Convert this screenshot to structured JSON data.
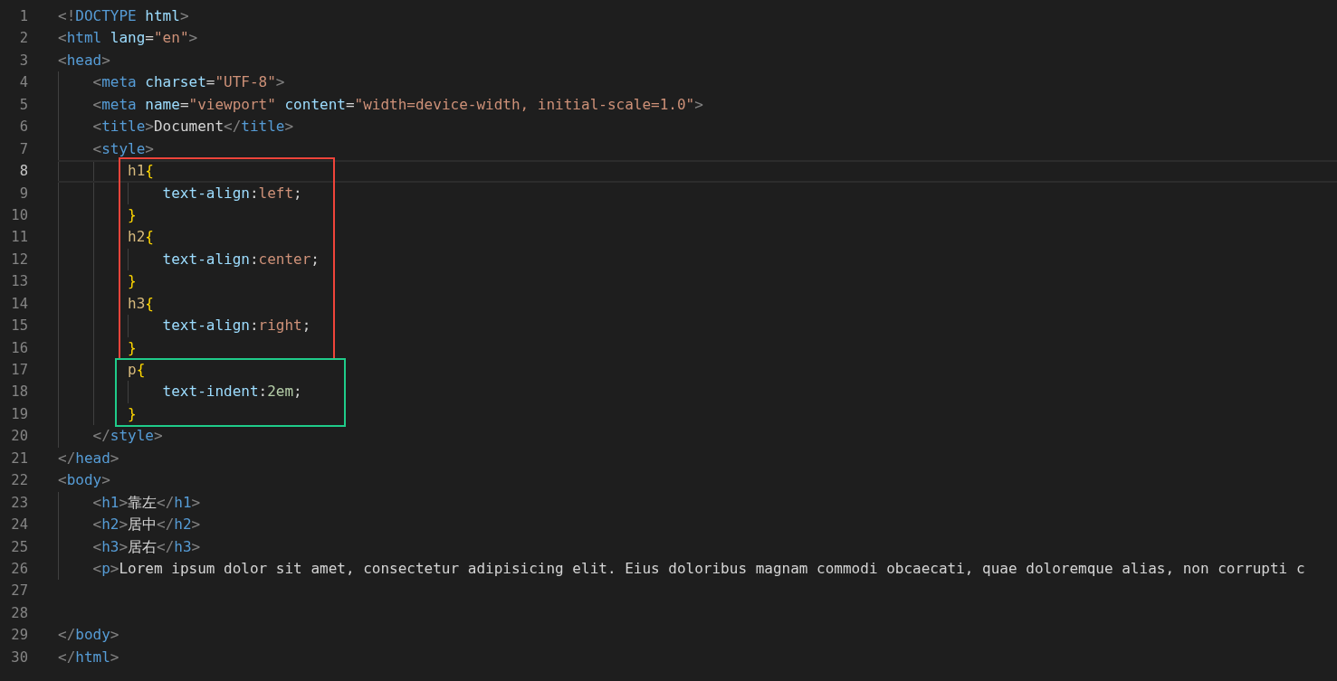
{
  "editor": {
    "sections": [
      {
        "lines": [
          {
            "number": "1",
            "current": false,
            "tokens": [
              {
                "kind": "punct",
                "text": "<!"
              },
              {
                "kind": "tag",
                "text": "DOCTYPE"
              },
              {
                "kind": "attr",
                "text": " html"
              },
              {
                "kind": "punct",
                "text": ">"
              }
            ]
          },
          {
            "number": "2",
            "current": false,
            "tokens": [
              {
                "kind": "punct",
                "text": "<"
              },
              {
                "kind": "tag",
                "text": "html"
              },
              {
                "kind": "attr",
                "text": " lang"
              },
              {
                "kind": "plain",
                "text": "="
              },
              {
                "kind": "string",
                "text": "\"en\""
              },
              {
                "kind": "punct",
                "text": ">"
              }
            ]
          },
          {
            "number": "3",
            "current": false,
            "tokens": [
              {
                "kind": "punct",
                "text": "<"
              },
              {
                "kind": "tag",
                "text": "head"
              },
              {
                "kind": "punct",
                "text": ">"
              }
            ]
          },
          {
            "number": "4",
            "current": false,
            "tokens": [
              {
                "kind": "punct",
                "text": "    <"
              },
              {
                "kind": "tag",
                "text": "meta"
              },
              {
                "kind": "attr",
                "text": " charset"
              },
              {
                "kind": "plain",
                "text": "="
              },
              {
                "kind": "string",
                "text": "\"UTF-8\""
              },
              {
                "kind": "punct",
                "text": ">"
              }
            ]
          },
          {
            "number": "5",
            "current": false,
            "tokens": [
              {
                "kind": "punct",
                "text": "    <"
              },
              {
                "kind": "tag",
                "text": "meta"
              },
              {
                "kind": "attr",
                "text": " name"
              },
              {
                "kind": "plain",
                "text": "="
              },
              {
                "kind": "string",
                "text": "\"viewport\""
              },
              {
                "kind": "attr",
                "text": " content"
              },
              {
                "kind": "plain",
                "text": "="
              },
              {
                "kind": "string",
                "text": "\"width=device-width, initial-scale=1.0\""
              },
              {
                "kind": "punct",
                "text": ">"
              }
            ]
          },
          {
            "number": "6",
            "current": false,
            "tokens": [
              {
                "kind": "punct",
                "text": "    <"
              },
              {
                "kind": "tag",
                "text": "title"
              },
              {
                "kind": "punct",
                "text": ">"
              },
              {
                "kind": "plain",
                "text": "Document"
              },
              {
                "kind": "punct",
                "text": "</"
              },
              {
                "kind": "tag",
                "text": "title"
              },
              {
                "kind": "punct",
                "text": ">"
              }
            ]
          },
          {
            "number": "7",
            "current": false,
            "tokens": [
              {
                "kind": "punct",
                "text": "    <"
              },
              {
                "kind": "tag",
                "text": "style"
              },
              {
                "kind": "punct",
                "text": ">"
              }
            ]
          }
        ]
      },
      {
        "color": "#f0443a",
        "lines": [
          {
            "number": "8",
            "current": true,
            "tokens": [
              {
                "kind": "selector",
                "text": "        h1"
              },
              {
                "kind": "brace",
                "text": "{"
              }
            ]
          },
          {
            "number": "9",
            "current": false,
            "tokens": [
              {
                "kind": "property",
                "text": "            text-align"
              },
              {
                "kind": "plain",
                "text": ":"
              },
              {
                "kind": "string",
                "text": "left"
              },
              {
                "kind": "plain",
                "text": ";"
              }
            ]
          },
          {
            "number": "10",
            "current": false,
            "tokens": [
              {
                "kind": "brace",
                "text": "        }"
              }
            ]
          },
          {
            "number": "11",
            "current": false,
            "tokens": [
              {
                "kind": "selector",
                "text": "        h2"
              },
              {
                "kind": "brace",
                "text": "{"
              }
            ]
          },
          {
            "number": "12",
            "current": false,
            "tokens": [
              {
                "kind": "property",
                "text": "            text-align"
              },
              {
                "kind": "plain",
                "text": ":"
              },
              {
                "kind": "string",
                "text": "center"
              },
              {
                "kind": "plain",
                "text": ";"
              }
            ]
          },
          {
            "number": "13",
            "current": false,
            "tokens": [
              {
                "kind": "brace",
                "text": "        }"
              }
            ]
          },
          {
            "number": "14",
            "current": false,
            "tokens": [
              {
                "kind": "selector",
                "text": "        h3"
              },
              {
                "kind": "brace",
                "text": "{"
              }
            ]
          },
          {
            "number": "15",
            "current": false,
            "tokens": [
              {
                "kind": "property",
                "text": "            text-align"
              },
              {
                "kind": "plain",
                "text": ":"
              },
              {
                "kind": "string",
                "text": "right"
              },
              {
                "kind": "plain",
                "text": ";"
              }
            ]
          },
          {
            "number": "16",
            "current": false,
            "tokens": [
              {
                "kind": "brace",
                "text": "        }"
              }
            ]
          }
        ]
      },
      {
        "color": "#1fcc8a",
        "lines": [
          {
            "number": "17",
            "current": false,
            "tokens": [
              {
                "kind": "selector",
                "text": "        p"
              },
              {
                "kind": "brace",
                "text": "{"
              }
            ]
          },
          {
            "number": "18",
            "current": false,
            "tokens": [
              {
                "kind": "property",
                "text": "            text-indent"
              },
              {
                "kind": "plain",
                "text": ":"
              },
              {
                "kind": "number",
                "text": "2em"
              },
              {
                "kind": "plain",
                "text": ";"
              }
            ]
          },
          {
            "number": "19",
            "current": false,
            "tokens": [
              {
                "kind": "brace",
                "text": "        }"
              }
            ]
          }
        ]
      },
      {
        "lines": [
          {
            "number": "20",
            "current": false,
            "tokens": [
              {
                "kind": "punct",
                "text": "    </"
              },
              {
                "kind": "tag",
                "text": "style"
              },
              {
                "kind": "punct",
                "text": ">"
              }
            ]
          },
          {
            "number": "21",
            "current": false,
            "tokens": [
              {
                "kind": "punct",
                "text": "</"
              },
              {
                "kind": "tag",
                "text": "head"
              },
              {
                "kind": "punct",
                "text": ">"
              }
            ]
          },
          {
            "number": "22",
            "current": false,
            "tokens": [
              {
                "kind": "punct",
                "text": "<"
              },
              {
                "kind": "tag",
                "text": "body"
              },
              {
                "kind": "punct",
                "text": ">"
              }
            ]
          },
          {
            "number": "23",
            "current": false,
            "tokens": [
              {
                "kind": "punct",
                "text": "    <"
              },
              {
                "kind": "tag",
                "text": "h1"
              },
              {
                "kind": "punct",
                "text": ">"
              },
              {
                "kind": "plain",
                "text": "靠左"
              },
              {
                "kind": "punct",
                "text": "</"
              },
              {
                "kind": "tag",
                "text": "h1"
              },
              {
                "kind": "punct",
                "text": ">"
              }
            ]
          },
          {
            "number": "24",
            "current": false,
            "tokens": [
              {
                "kind": "punct",
                "text": "    <"
              },
              {
                "kind": "tag",
                "text": "h2"
              },
              {
                "kind": "punct",
                "text": ">"
              },
              {
                "kind": "plain",
                "text": "居中"
              },
              {
                "kind": "punct",
                "text": "</"
              },
              {
                "kind": "tag",
                "text": "h2"
              },
              {
                "kind": "punct",
                "text": ">"
              }
            ]
          },
          {
            "number": "25",
            "current": false,
            "tokens": [
              {
                "kind": "punct",
                "text": "    <"
              },
              {
                "kind": "tag",
                "text": "h3"
              },
              {
                "kind": "punct",
                "text": ">"
              },
              {
                "kind": "plain",
                "text": "居右"
              },
              {
                "kind": "punct",
                "text": "</"
              },
              {
                "kind": "tag",
                "text": "h3"
              },
              {
                "kind": "punct",
                "text": ">"
              }
            ]
          },
          {
            "number": "26",
            "current": false,
            "tokens": [
              {
                "kind": "punct",
                "text": "    <"
              },
              {
                "kind": "tag",
                "text": "p"
              },
              {
                "kind": "punct",
                "text": ">"
              },
              {
                "kind": "plain",
                "text": "Lorem ipsum dolor sit amet, consectetur adipisicing elit. Eius doloribus magnam commodi obcaecati, quae doloremque alias, non corrupti c"
              }
            ]
          },
          {
            "number": "27",
            "current": false
          },
          {
            "number": "28",
            "current": false
          },
          {
            "number": "29",
            "current": false,
            "tokens": [
              {
                "kind": "punct",
                "text": "</"
              },
              {
                "kind": "tag",
                "text": "body"
              },
              {
                "kind": "punct",
                "text": ">"
              }
            ]
          },
          {
            "number": "30",
            "current": false,
            "tokens": [
              {
                "kind": "punct",
                "text": "</"
              },
              {
                "kind": "tag",
                "text": "html"
              },
              {
                "kind": "punct",
                "text": ">"
              }
            ]
          }
        ]
      }
    ]
  }
}
